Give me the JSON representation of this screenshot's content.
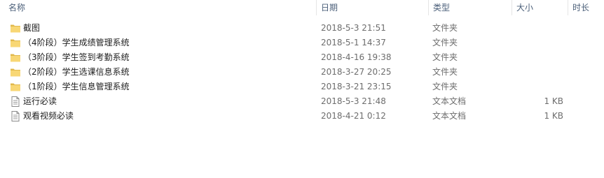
{
  "columns": {
    "name": "名称",
    "date": "日期",
    "type": "类型",
    "size": "大小",
    "duration": "时长"
  },
  "files": [
    {
      "name": "截图",
      "date": "2018-5-3 21:51",
      "type": "文件夹",
      "size": "",
      "icon": "folder-icon"
    },
    {
      "name": "（4阶段）学生成绩管理系统",
      "date": "2018-5-1 14:37",
      "type": "文件夹",
      "size": "",
      "icon": "folder-icon"
    },
    {
      "name": "（3阶段）学生签到考勤系统",
      "date": "2018-4-16 19:38",
      "type": "文件夹",
      "size": "",
      "icon": "folder-icon"
    },
    {
      "name": "（2阶段）学生选课信息系统",
      "date": "2018-3-27 20:25",
      "type": "文件夹",
      "size": "",
      "icon": "folder-icon"
    },
    {
      "name": "（1阶段）学生信息管理系统",
      "date": "2018-3-21 23:15",
      "type": "文件夹",
      "size": "",
      "icon": "folder-icon"
    },
    {
      "name": "运行必读",
      "date": "2018-5-3 21:48",
      "type": "文本文档",
      "size": "1 KB",
      "icon": "text-document-icon"
    },
    {
      "name": "观看视频必读",
      "date": "2018-4-21 0:12",
      "type": "文本文档",
      "size": "1 KB",
      "icon": "text-document-icon"
    }
  ],
  "colors": {
    "header_text": "#4c607a",
    "secondary_text": "#6d6d6d",
    "folder_yellow": "#f8d775",
    "folder_shadow": "#e0b84c"
  }
}
